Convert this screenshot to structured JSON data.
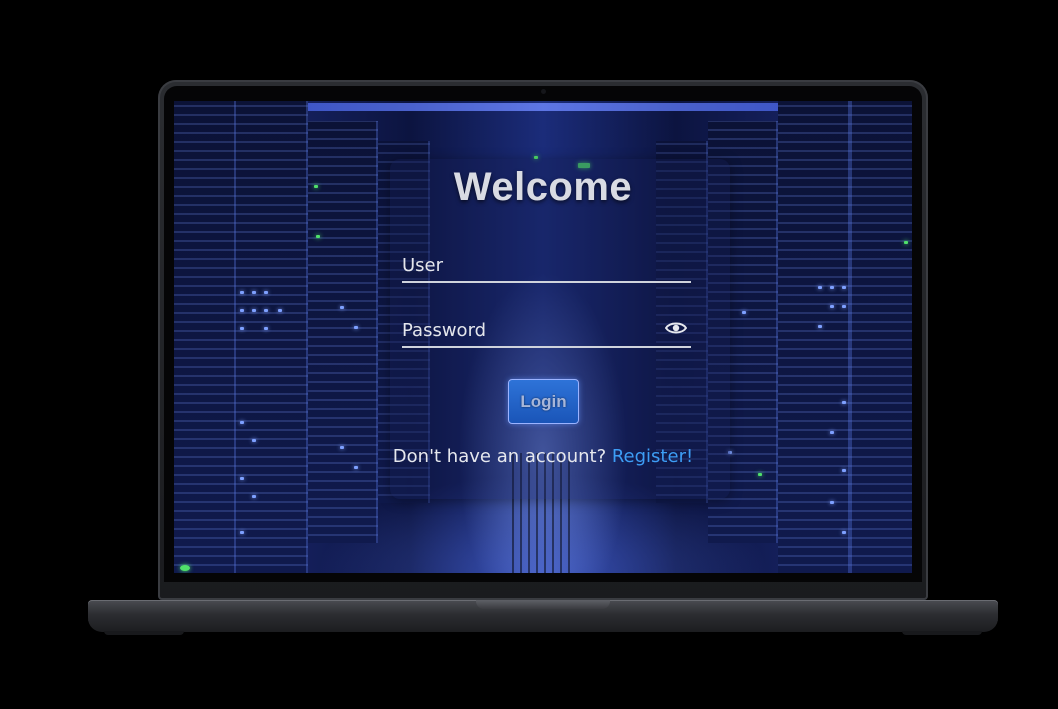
{
  "login": {
    "title": "Welcome",
    "user_placeholder": "User",
    "password_placeholder": "Password",
    "login_label": "Login",
    "register_prompt": "Don't have an account?",
    "register_link": "Register!"
  },
  "icons": {
    "password_toggle": "eye-icon"
  },
  "colors": {
    "link": "#3d9df5",
    "button": "#2e73d8",
    "title": "#d9dbe3"
  }
}
